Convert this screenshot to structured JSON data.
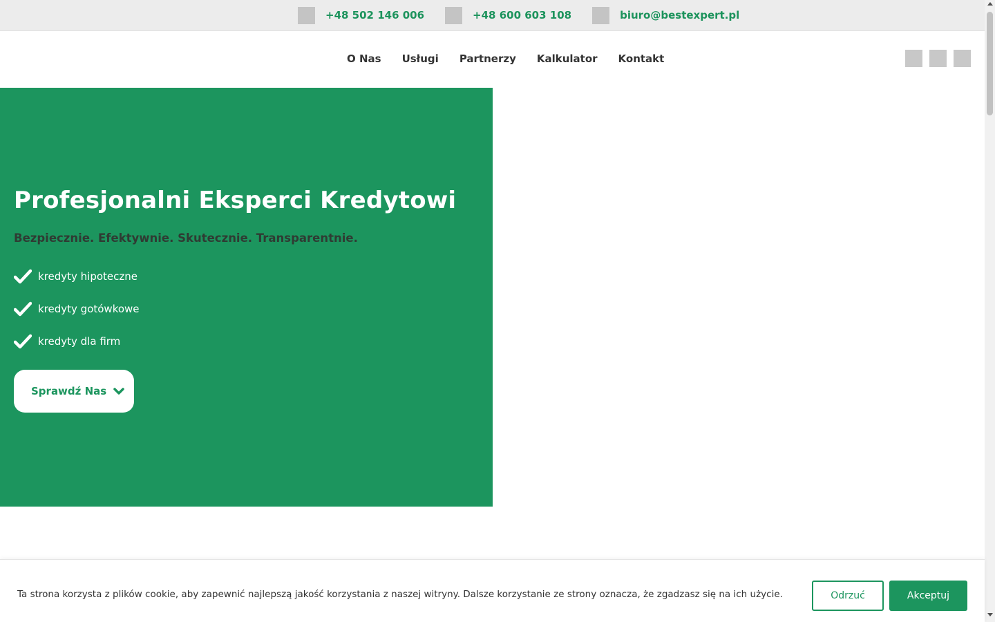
{
  "topbar": {
    "contacts": [
      {
        "icon": "phone-icon",
        "text": "+48 502 146 006"
      },
      {
        "icon": "phone-icon",
        "text": "+48 600 603 108"
      },
      {
        "icon": "email-icon",
        "text": "biuro@bestexpert.pl"
      }
    ]
  },
  "nav": {
    "items": [
      {
        "label": "O Nas"
      },
      {
        "label": "Usługi"
      },
      {
        "label": "Partnerzy"
      },
      {
        "label": "Kalkulator"
      },
      {
        "label": "Kontakt"
      }
    ],
    "social_icons": [
      "social-icon-1",
      "social-icon-2",
      "social-icon-3"
    ]
  },
  "hero": {
    "title": "Profesjonalni Eksperci Kredytowi",
    "subtitle": "Bezpiecznie. Efektywnie. Skutecznie. Transparentnie.",
    "features": [
      {
        "label": "kredyty hipoteczne"
      },
      {
        "label": "kredyty gotówkowe"
      },
      {
        "label": "kredyty dla firm"
      }
    ],
    "cta_label": "Sprawdź Nas"
  },
  "cookie": {
    "text": "Ta strona korzysta z plików cookie, aby zapewnić najlepszą jakość korzystania z naszej witryny. Dalsze korzystanie ze strony oznacza, że zgadzasz się na ich użycie.",
    "reject_label": "Odrzuć",
    "accept_label": "Akceptuj"
  },
  "colors": {
    "brand_green": "#1c955e",
    "topbar_bg": "#ececec",
    "text_dark": "#333333"
  }
}
